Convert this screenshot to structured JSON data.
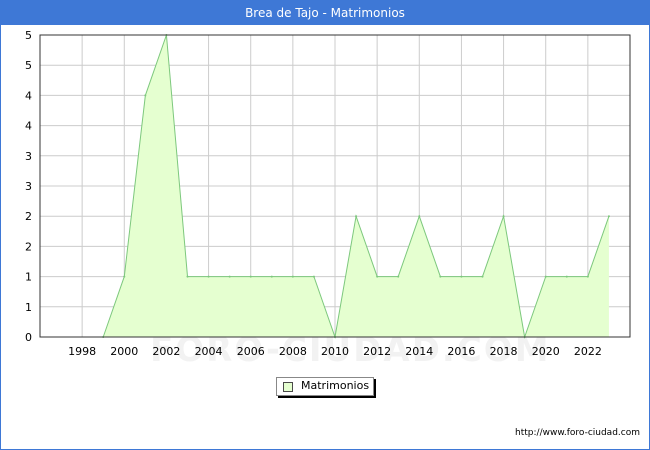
{
  "title": "Brea de Tajo - Matrimonios",
  "watermark": "FORO-CIUDAD.COM",
  "source_url": "http://www.foro-ciudad.com",
  "colors": {
    "title_bg": "#3e78d6",
    "area_fill": "#e5ffd0",
    "line": "#7dc87d",
    "grid": "#cccccc"
  },
  "chart_data": {
    "type": "area",
    "title": "Brea de Tajo - Matrimonios",
    "xlabel": "",
    "ylabel": "",
    "x": [
      1999,
      2000,
      2001,
      2002,
      2003,
      2004,
      2005,
      2006,
      2007,
      2008,
      2009,
      2010,
      2011,
      2012,
      2013,
      2014,
      2015,
      2016,
      2017,
      2018,
      2019,
      2020,
      2021,
      2022,
      2023
    ],
    "series": [
      {
        "name": "Matrimonios",
        "values": [
          0,
          1,
          4,
          5,
          1,
          1,
          1,
          1,
          1,
          1,
          1,
          0,
          2,
          1,
          1,
          2,
          1,
          1,
          1,
          2,
          0,
          1,
          1,
          1,
          2
        ]
      }
    ],
    "xlim": [
      1996,
      2024
    ],
    "ylim": [
      0,
      5
    ],
    "x_ticks": [
      "1998",
      "2000",
      "2002",
      "2004",
      "2006",
      "2008",
      "2010",
      "2012",
      "2014",
      "2016",
      "2018",
      "2020",
      "2022"
    ],
    "y_tick_labels": [
      "0",
      "1",
      "1",
      "2",
      "2",
      "3",
      "3",
      "4",
      "4",
      "5",
      "5"
    ],
    "grid": true,
    "legend": "bottom-center"
  }
}
